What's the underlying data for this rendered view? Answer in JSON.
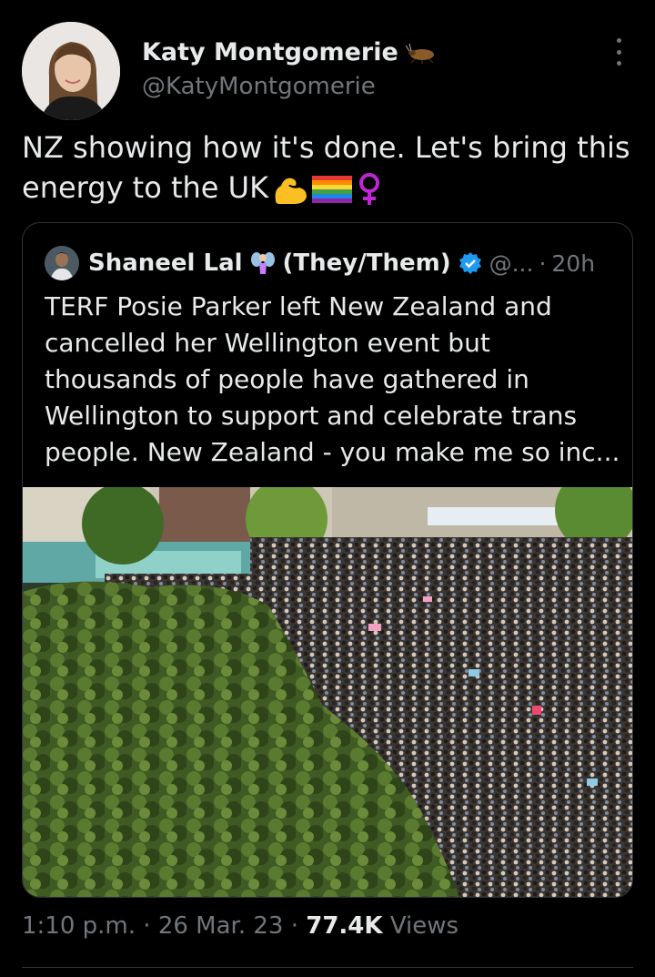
{
  "author": {
    "name": "Katy Montgomerie",
    "handle": "@KatyMontgomerie",
    "name_emoji": "cockroach-emoji",
    "avatar": "profile-photo"
  },
  "tweet": {
    "text_line1": "NZ showing how it's done. Let's bring this",
    "text_line2": "energy to the UK",
    "emojis": [
      "flexed-biceps-emoji",
      "rainbow-flag-emoji",
      "female-sign-emoji"
    ]
  },
  "quote": {
    "name": "Shaneel Lal",
    "name_emoji": "fairy-emoji",
    "pronouns": "(They/Them)",
    "verified_icon": "verified-badge-icon",
    "handle": "@...",
    "separator": "·",
    "time": "20h",
    "text_lines": [
      "TERF Posie Parker left New Zealand and",
      "cancelled her Wellington event but",
      "thousands of people have gathered in",
      "Wellington to support and celebrate trans",
      "people. New Zealand - you make me so inc..."
    ],
    "photo": "crowd-rally-photo"
  },
  "meta": {
    "time": "1:10 p.m.",
    "sep1": "·",
    "date": "26 Mar. 23",
    "sep2": "·",
    "views_count": "77.4K",
    "views_label": "Views"
  },
  "colors": {
    "background": "#000000",
    "text_primary": "#e7e9ea",
    "text_secondary": "#71767b",
    "border": "#2f3336",
    "verified": "#1d9bf0"
  }
}
